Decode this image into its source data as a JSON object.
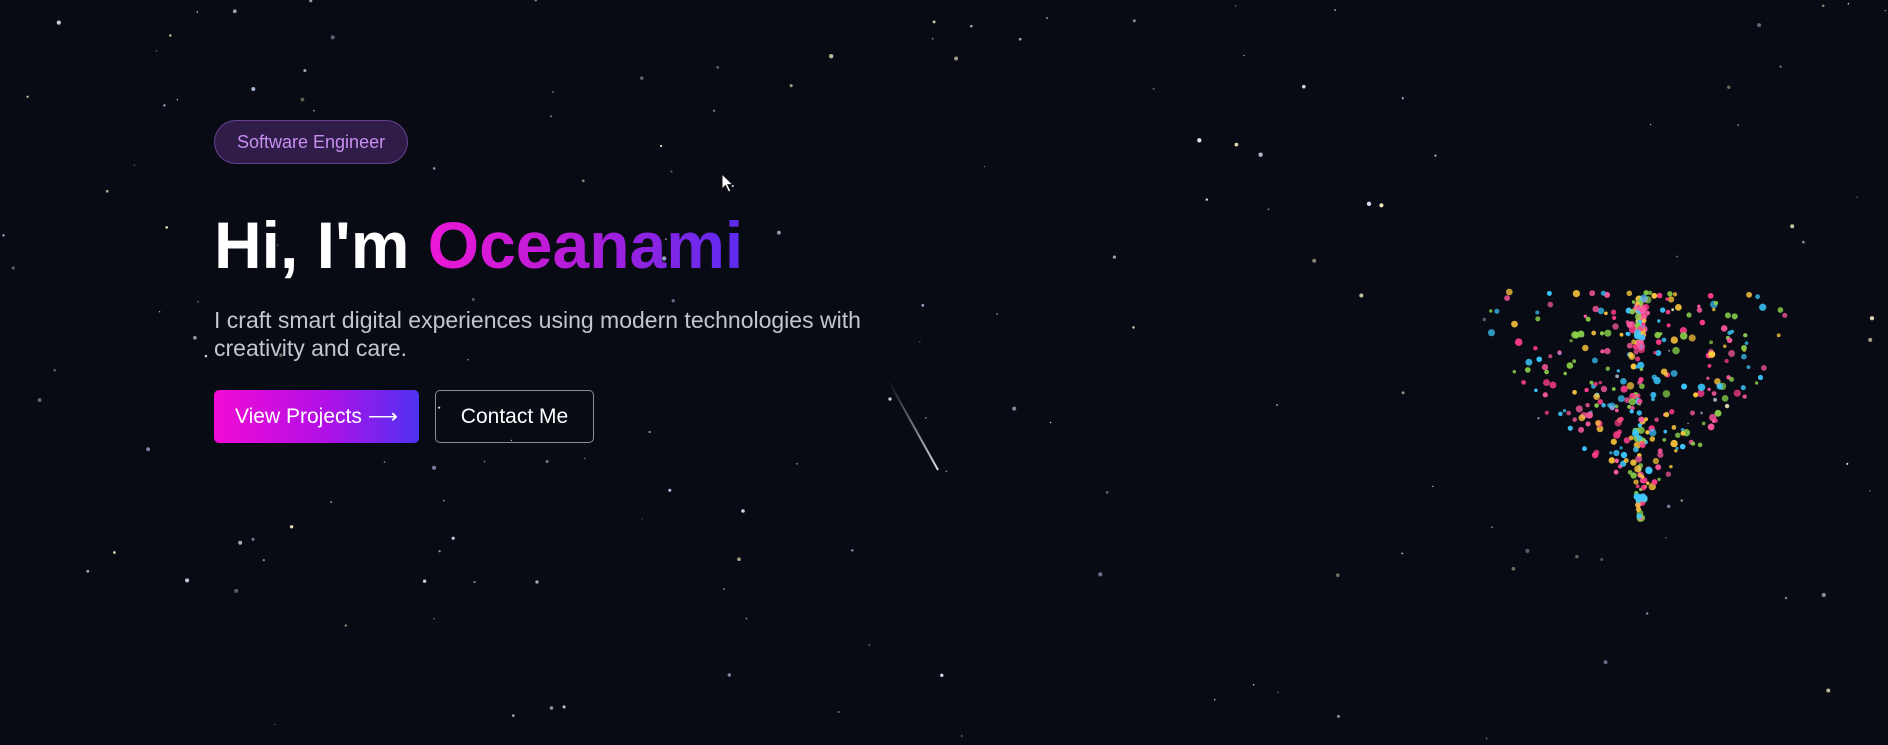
{
  "hero": {
    "badge": "Software Engineer",
    "greeting": "Hi, I'm ",
    "name": "Oceanami",
    "tagline": "I craft smart digital experiences using modern technologies with creativity and care.",
    "primary_button": {
      "label": "View Projects",
      "icon": "arrow-right-icon",
      "glyph": "⟶"
    },
    "secondary_button": {
      "label": "Contact Me"
    }
  },
  "colors": {
    "background": "#080b14",
    "accent_pink": "#ec18d6",
    "accent_violet": "#5a2cf0",
    "heart_dots": [
      "#ff3d8b",
      "#ffc83d",
      "#3dc8ff",
      "#8ad14a",
      "#ff5aa0"
    ]
  }
}
